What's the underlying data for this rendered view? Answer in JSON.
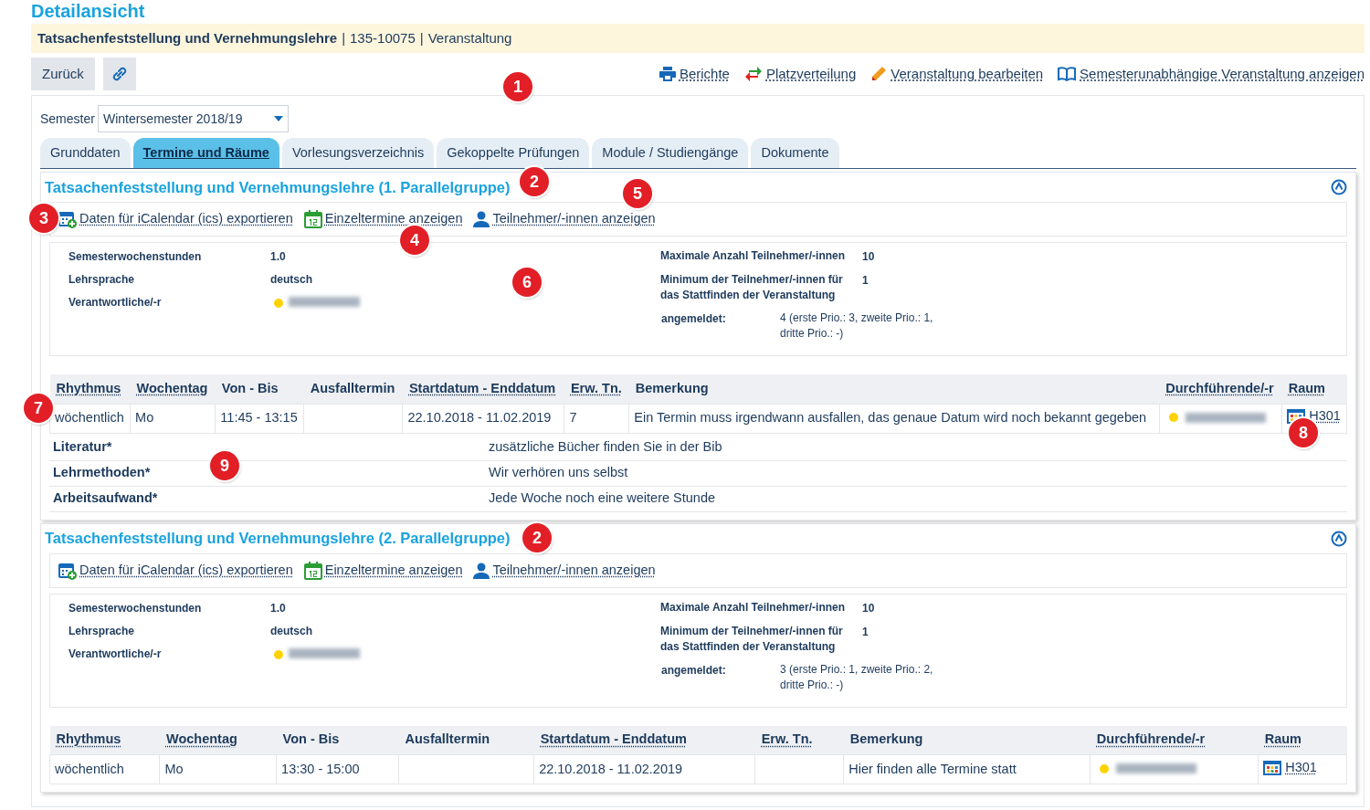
{
  "page_title": "Detailansicht",
  "header": {
    "title": "Tatsachenfeststellung und Vernehmungslehre",
    "separator_1": "|",
    "number": "135-10075",
    "separator_2": "|",
    "type": "Veranstaltung"
  },
  "buttons": [
    {
      "kind": "text",
      "label": "Zurück"
    },
    {
      "kind": "link-icon"
    }
  ],
  "actions": [
    {
      "kind": "printer",
      "label": "Berichte"
    },
    {
      "kind": "arrows",
      "label": "Platzverteilung"
    },
    {
      "kind": "pencil",
      "label": "Veranstaltung bearbeiten"
    },
    {
      "kind": "book",
      "label": "Semesterunabhängige Veranstaltung anzeigen"
    }
  ],
  "semester": {
    "label": "Semester",
    "value": "Wintersemester 2018/19"
  },
  "tabs": [
    {
      "label": "Grunddaten",
      "selected": false
    },
    {
      "label": "Termine und Räume",
      "selected": true
    },
    {
      "label": "Vorlesungsverzeichnis",
      "selected": false
    },
    {
      "label": "Gekoppelte Prüfungen",
      "selected": false
    },
    {
      "label": "Module / Studiengänge",
      "selected": false
    },
    {
      "label": "Dokumente",
      "selected": false
    }
  ],
  "sections": [
    {
      "title": "Tatsachenfeststellung und Vernehmungslehre (1. Parallelgruppe)",
      "expanded": true,
      "links": [
        {
          "kind": "calendar-add",
          "label": "Daten für iCalendar (ics) exportieren"
        },
        {
          "kind": "calendar-day",
          "label": "Einzeltermine anzeigen"
        },
        {
          "kind": "person",
          "label": "Teilnehmer/-innen anzeigen"
        }
      ],
      "info_left": [
        {
          "label": "Semesterwochenstunden",
          "value": "1.0"
        },
        {
          "label": "Lehrsprache",
          "value": "deutsch"
        },
        {
          "label": "Verantwortliche/-r",
          "kind": "person"
        }
      ],
      "info_right": [
        {
          "label": "Maximale Anzahl Teilnehmer/-innen",
          "value": "10"
        },
        {
          "label": "Minimum der Teilnehmer/-innen für das Stattfinden der Veranstaltung",
          "value": "1"
        },
        {
          "label": "angemeldet:",
          "value": "4 (erste Prio.: 3, zweite Prio.: 1, dritte Prio.: -)",
          "kind": "registered"
        }
      ],
      "columns": [
        {
          "label": "Rhythmus",
          "sortable": true
        },
        {
          "label": "Wochentag",
          "sortable": true
        },
        {
          "label": "Von - Bis",
          "sortable": false
        },
        {
          "label": "Ausfalltermin",
          "sortable": false
        },
        {
          "label": "Startdatum - Enddatum",
          "sortable": true
        },
        {
          "label": "Erw. Tn.",
          "sortable": true
        },
        {
          "label": "Bemerkung",
          "sortable": false
        },
        {
          "label": "Durchführende/-r",
          "sortable": true
        },
        {
          "label": "Raum",
          "sortable": true
        }
      ],
      "rows": [
        {
          "rhythm": "wöchentlich",
          "weekday": "Mo",
          "time": "11:45 - 13:15",
          "cancelled": "",
          "dates": "22.10.2018 - 11.02.2019",
          "expected": "7",
          "remark": "Ein Termin muss irgendwann ausfallen, das genaue Datum wird noch bekannt gegeben",
          "room": "H301"
        }
      ],
      "fields": [
        {
          "label": "Literatur*",
          "value": "zusätzliche Bücher finden Sie in der Bib"
        },
        {
          "label": "Lehrmethoden*",
          "value": "Wir verhören uns selbst"
        },
        {
          "label": "Arbeitsaufwand*",
          "value": "Jede Woche noch eine weitere Stunde"
        }
      ]
    },
    {
      "title": "Tatsachenfeststellung und Vernehmungslehre (2. Parallelgruppe)",
      "expanded": true,
      "links": [
        {
          "kind": "calendar-add",
          "label": "Daten für iCalendar (ics) exportieren"
        },
        {
          "kind": "calendar-day",
          "label": "Einzeltermine anzeigen"
        },
        {
          "kind": "person",
          "label": "Teilnehmer/-innen anzeigen"
        }
      ],
      "info_left": [
        {
          "label": "Semesterwochenstunden",
          "value": "1.0"
        },
        {
          "label": "Lehrsprache",
          "value": "deutsch"
        },
        {
          "label": "Verantwortliche/-r",
          "kind": "person"
        }
      ],
      "info_right": [
        {
          "label": "Maximale Anzahl Teilnehmer/-innen",
          "value": "10"
        },
        {
          "label": "Minimum der Teilnehmer/-innen für das Stattfinden der Veranstaltung",
          "value": "1"
        },
        {
          "label": "angemeldet:",
          "value": "3 (erste Prio.: 1, zweite Prio.: 2, dritte Prio.: -)",
          "kind": "registered"
        }
      ],
      "columns": [
        {
          "label": "Rhythmus",
          "sortable": true
        },
        {
          "label": "Wochentag",
          "sortable": true
        },
        {
          "label": "Von - Bis",
          "sortable": false
        },
        {
          "label": "Ausfalltermin",
          "sortable": false
        },
        {
          "label": "Startdatum - Enddatum",
          "sortable": true
        },
        {
          "label": "Erw. Tn.",
          "sortable": true
        },
        {
          "label": "Bemerkung",
          "sortable": false
        },
        {
          "label": "Durchführende/-r",
          "sortable": true
        },
        {
          "label": "Raum",
          "sortable": true
        }
      ],
      "rows": [
        {
          "rhythm": "wöchentlich",
          "weekday": "Mo",
          "time": "13:30 - 15:00",
          "cancelled": "",
          "dates": "22.10.2018 - 11.02.2019",
          "expected": "",
          "remark": "Hier finden alle Termine statt",
          "room": "H301"
        }
      ]
    }
  ],
  "callouts": [
    {
      "number": "1"
    },
    {
      "number": "2"
    },
    {
      "number": "3"
    },
    {
      "number": "4"
    },
    {
      "number": "5"
    },
    {
      "number": "6"
    },
    {
      "number": "7"
    },
    {
      "number": "8"
    },
    {
      "number": "9"
    },
    {
      "number": "2"
    }
  ]
}
